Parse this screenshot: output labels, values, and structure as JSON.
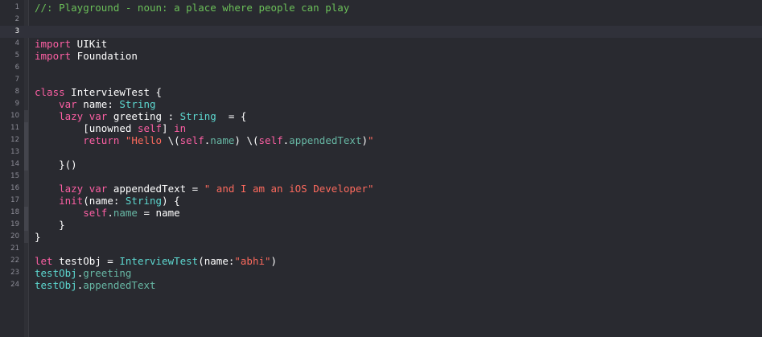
{
  "editor": {
    "line_numbers": [
      "1",
      "2",
      "3",
      "4",
      "5",
      "6",
      "7",
      "8",
      "9",
      "10",
      "11",
      "12",
      "13",
      "14",
      "15",
      "16",
      "17",
      "18",
      "19",
      "20",
      "21",
      "22",
      "23",
      "24"
    ],
    "lines": [
      [
        {
          "t": "//: Playground - noun: a place where people can play",
          "c": "cmt"
        }
      ],
      [],
      [],
      [
        {
          "t": "import",
          "c": "kw"
        },
        {
          "t": " UIKit",
          "c": "plain"
        }
      ],
      [
        {
          "t": "import",
          "c": "kw"
        },
        {
          "t": " Foundation",
          "c": "plain"
        }
      ],
      [],
      [],
      [
        {
          "t": "class",
          "c": "kw"
        },
        {
          "t": " InterviewTest {",
          "c": "plain"
        }
      ],
      [
        {
          "t": "    ",
          "c": "plain"
        },
        {
          "t": "var",
          "c": "kw"
        },
        {
          "t": " name: ",
          "c": "plain"
        },
        {
          "t": "String",
          "c": "type"
        }
      ],
      [
        {
          "t": "    ",
          "c": "plain"
        },
        {
          "t": "lazy",
          "c": "kw"
        },
        {
          "t": " ",
          "c": "plain"
        },
        {
          "t": "var",
          "c": "kw"
        },
        {
          "t": " greeting : ",
          "c": "plain"
        },
        {
          "t": "String",
          "c": "type"
        },
        {
          "t": "  = {",
          "c": "plain"
        }
      ],
      [
        {
          "t": "        [unowned ",
          "c": "plain"
        },
        {
          "t": "self",
          "c": "kw"
        },
        {
          "t": "] ",
          "c": "plain"
        },
        {
          "t": "in",
          "c": "kw"
        }
      ],
      [
        {
          "t": "        ",
          "c": "plain"
        },
        {
          "t": "return",
          "c": "kw"
        },
        {
          "t": " \"Hello ",
          "c": "str"
        },
        {
          "t": "\\(",
          "c": "plain"
        },
        {
          "t": "self",
          "c": "kw"
        },
        {
          "t": ".",
          "c": "plain"
        },
        {
          "t": "name",
          "c": "prop"
        },
        {
          "t": ") ",
          "c": "plain"
        },
        {
          "t": "\\(",
          "c": "plain"
        },
        {
          "t": "self",
          "c": "kw"
        },
        {
          "t": ".",
          "c": "plain"
        },
        {
          "t": "appendedText",
          "c": "prop"
        },
        {
          "t": ")",
          "c": "plain"
        },
        {
          "t": "\"",
          "c": "str"
        }
      ],
      [],
      [
        {
          "t": "    }()",
          "c": "plain"
        }
      ],
      [],
      [
        {
          "t": "    ",
          "c": "plain"
        },
        {
          "t": "lazy",
          "c": "kw"
        },
        {
          "t": " ",
          "c": "plain"
        },
        {
          "t": "var",
          "c": "kw"
        },
        {
          "t": " appendedText = ",
          "c": "plain"
        },
        {
          "t": "\" and I am an iOS Developer\"",
          "c": "str"
        }
      ],
      [
        {
          "t": "    ",
          "c": "plain"
        },
        {
          "t": "init",
          "c": "kw"
        },
        {
          "t": "(name: ",
          "c": "plain"
        },
        {
          "t": "String",
          "c": "type"
        },
        {
          "t": ") {",
          "c": "plain"
        }
      ],
      [
        {
          "t": "        ",
          "c": "plain"
        },
        {
          "t": "self",
          "c": "kw"
        },
        {
          "t": ".",
          "c": "plain"
        },
        {
          "t": "name",
          "c": "prop"
        },
        {
          "t": " = name",
          "c": "plain"
        }
      ],
      [
        {
          "t": "    }",
          "c": "plain"
        }
      ],
      [
        {
          "t": "}",
          "c": "plain"
        }
      ],
      [],
      [
        {
          "t": "let",
          "c": "kw"
        },
        {
          "t": " testObj = ",
          "c": "plain"
        },
        {
          "t": "InterviewTest",
          "c": "type"
        },
        {
          "t": "(name:",
          "c": "plain"
        },
        {
          "t": "\"abhi\"",
          "c": "str"
        },
        {
          "t": ")",
          "c": "plain"
        }
      ],
      [
        {
          "t": "testObj",
          "c": "type"
        },
        {
          "t": ".",
          "c": "plain"
        },
        {
          "t": "greeting",
          "c": "prop"
        }
      ],
      [
        {
          "t": "testObj",
          "c": "type"
        },
        {
          "t": ".",
          "c": "plain"
        },
        {
          "t": "appendedText",
          "c": "prop"
        }
      ]
    ],
    "current_line": 3
  },
  "colors": {
    "background": "#292a30",
    "keyword": "#fc5fa3",
    "type": "#5dd8d0",
    "string": "#fc6a5d",
    "comment": "#6bbf59",
    "property": "#67b7a4"
  }
}
